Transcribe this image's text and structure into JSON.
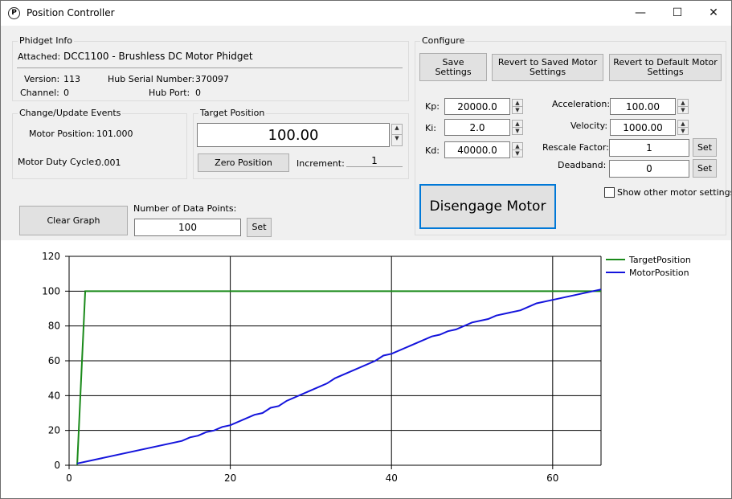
{
  "window": {
    "title": "Position Controller",
    "minimize_glyph": "—",
    "maximize_glyph": "☐",
    "close_glyph": "✕"
  },
  "phidget_info": {
    "title": "Phidget Info",
    "attached_label": "Attached:",
    "attached_value": "DCC1100 - Brushless DC Motor Phidget",
    "version_label": "Version:",
    "version_value": "113",
    "hub_serial_label": "Hub Serial Number:",
    "hub_serial_value": "370097",
    "channel_label": "Channel:",
    "channel_value": "0",
    "hub_port_label": "Hub Port:",
    "hub_port_value": "0"
  },
  "events": {
    "title": "Change/Update Events",
    "motor_position_label": "Motor Position:",
    "motor_position_value": "101.000",
    "duty_cycle_label": "Motor Duty Cycle:",
    "duty_cycle_value": "0.001"
  },
  "target": {
    "title": "Target Position",
    "value": "100.00",
    "zero_button": "Zero Position",
    "increment_label": "Increment:",
    "increment_value": "1"
  },
  "graph_controls": {
    "clear_button": "Clear Graph",
    "data_points_label": "Number of Data Points:",
    "data_points_value": "100",
    "set_button": "Set"
  },
  "configure": {
    "title": "Configure",
    "save_button": "Save Settings",
    "revert_saved_button": "Revert to Saved Motor Settings",
    "revert_default_button": "Revert to Default Motor Settings",
    "kp_label": "Kp:",
    "kp_value": "20000.0",
    "ki_label": "Ki:",
    "ki_value": "2.0",
    "kd_label": "Kd:",
    "kd_value": "40000.0",
    "acceleration_label": "Acceleration:",
    "acceleration_value": "100.00",
    "velocity_label": "Velocity:",
    "velocity_value": "1000.00",
    "rescale_label": "Rescale Factor:",
    "rescale_value": "1",
    "rescale_set": "Set",
    "deadband_label": "Deadband:",
    "deadband_value": "0",
    "deadband_set": "Set",
    "disengage_button": "Disengage Motor",
    "show_other_label": "Show other motor settings"
  },
  "chart_data": {
    "type": "line",
    "xlim": [
      0,
      66
    ],
    "ylim": [
      0,
      120
    ],
    "x_ticks": [
      0,
      20,
      40,
      60
    ],
    "y_ticks": [
      0,
      20,
      40,
      60,
      80,
      100,
      120
    ],
    "grid": true,
    "legend_position": "top-right",
    "series": [
      {
        "name": "TargetPosition",
        "color": "#1a8a1a",
        "points": [
          [
            1,
            0
          ],
          [
            2,
            100
          ],
          [
            66,
            100
          ]
        ]
      },
      {
        "name": "MotorPosition",
        "color": "#1414dc",
        "points": [
          [
            1,
            1
          ],
          [
            14,
            14
          ],
          [
            15,
            16
          ],
          [
            16,
            17
          ],
          [
            17,
            19
          ],
          [
            18,
            20
          ],
          [
            19,
            22
          ],
          [
            20,
            23
          ],
          [
            23,
            29
          ],
          [
            24,
            30
          ],
          [
            25,
            33
          ],
          [
            26,
            34
          ],
          [
            27,
            37
          ],
          [
            32,
            47
          ],
          [
            33,
            50
          ],
          [
            38,
            60
          ],
          [
            39,
            63
          ],
          [
            40,
            64
          ],
          [
            45,
            74
          ],
          [
            46,
            75
          ],
          [
            47,
            77
          ],
          [
            48,
            78
          ],
          [
            50,
            82
          ],
          [
            52,
            84
          ],
          [
            53,
            86
          ],
          [
            56,
            89
          ],
          [
            58,
            93
          ],
          [
            60,
            95
          ],
          [
            66,
            101
          ]
        ]
      }
    ]
  }
}
